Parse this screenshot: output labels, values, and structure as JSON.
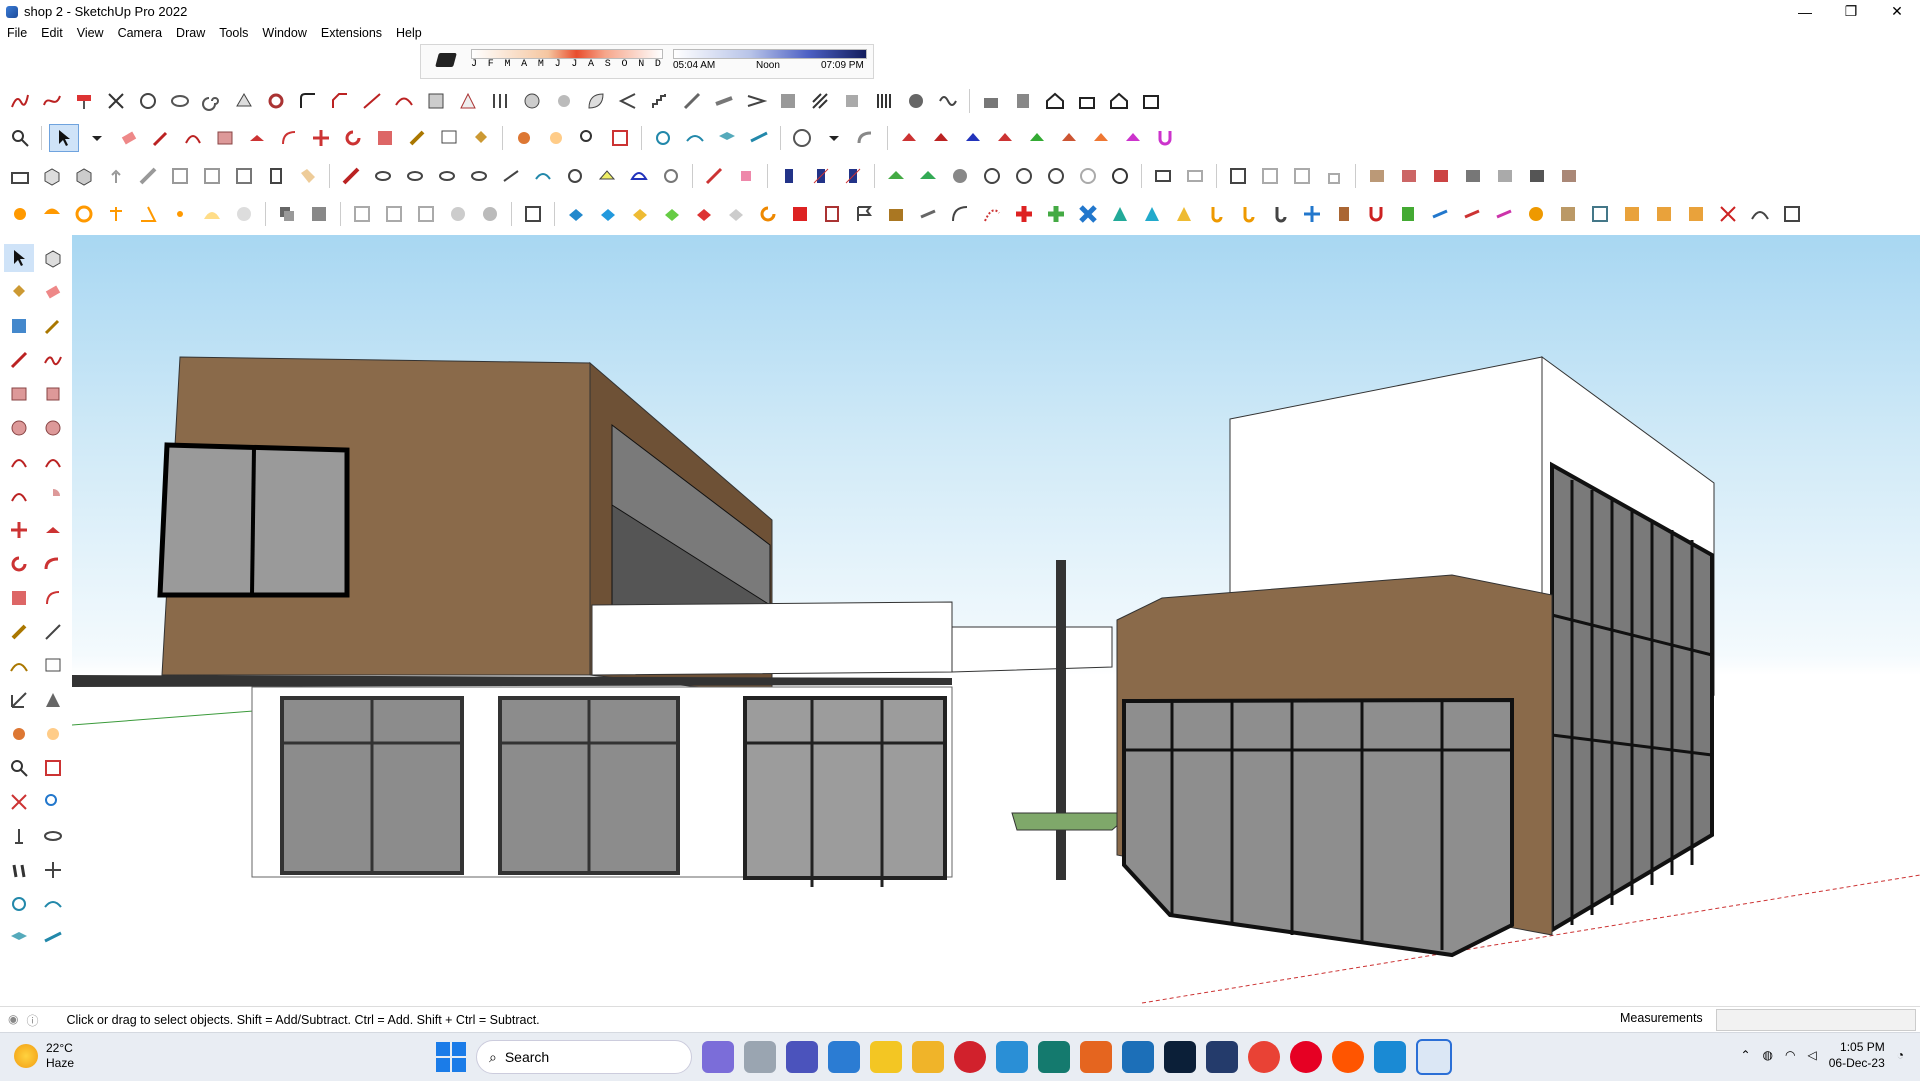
{
  "window": {
    "title": "shop 2 - SketchUp Pro 2022",
    "minimize": "—",
    "maximize": "❐",
    "close": "✕"
  },
  "menu": [
    "File",
    "Edit",
    "View",
    "Camera",
    "Draw",
    "Tools",
    "Window",
    "Extensions",
    "Help"
  ],
  "shadow": {
    "months": [
      "J",
      "F",
      "M",
      "A",
      "M",
      "J",
      "J",
      "A",
      "S",
      "O",
      "N",
      "D"
    ],
    "time_start": "05:04 AM",
    "time_mid": "Noon",
    "time_end": "07:09 PM"
  },
  "statusbar": {
    "hint": "Click or drag to select objects. Shift = Add/Subtract. Ctrl = Add. Shift + Ctrl = Subtract.",
    "measurements_label": "Measurements",
    "measurements_value": ""
  },
  "taskbar": {
    "temperature": "22°C",
    "weather": "Haze",
    "search_placeholder": "Search",
    "time": "1:05 PM",
    "date": "06-Dec-23"
  },
  "colors": {
    "accent": "#1b7ce8",
    "brown": "#8a6a4a",
    "glass": "#8c8c8c",
    "sky": "#a8d7f2"
  }
}
